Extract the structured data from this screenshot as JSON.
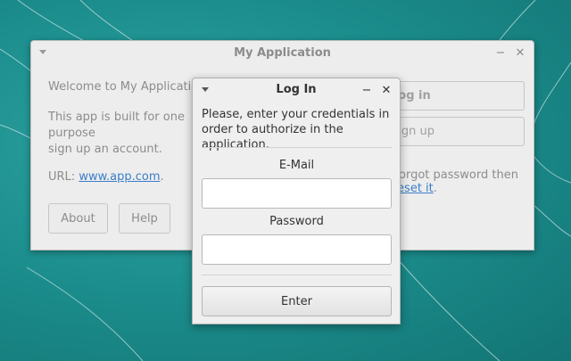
{
  "main_window": {
    "title": "My Application",
    "minimize_glyph": "−",
    "close_glyph": "✕",
    "welcome": "Welcome to My Application!",
    "description": "This app is built for one purpose\nsign up an account.",
    "url_label": "URL: ",
    "url_link": "www.app.com",
    "url_suffix": ".",
    "about_label": "About",
    "help_label": "Help",
    "login_label": "Log in",
    "signup_label": "Sign up",
    "forgot_prefix": "Forgot password then ",
    "reset_link": "reset it",
    "forgot_suffix": "."
  },
  "login_dialog": {
    "title": "Log In",
    "minimize_glyph": "−",
    "close_glyph": "✕",
    "instructions": "Please, enter your credentials in order to authorize in the application.",
    "email_label": "E-Mail",
    "email_value": "",
    "password_label": "Password",
    "password_value": "",
    "enter_label": "Enter"
  },
  "colors": {
    "desktop": "#1f8f8e",
    "window_bg": "#ededed",
    "link": "#3b7ec8"
  }
}
